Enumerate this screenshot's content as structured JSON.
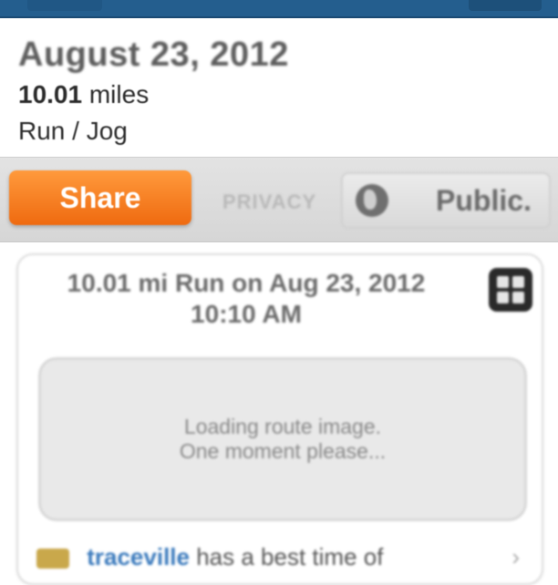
{
  "summary": {
    "date": "August 23, 2012",
    "distance_value": "10.01",
    "distance_unit": "miles",
    "activity_type": "Run / Jog"
  },
  "share_bar": {
    "share_label": "Share",
    "privacy_label": "PRIVACY",
    "privacy_value": "Public."
  },
  "card": {
    "title_line1": "10.01 mi Run on Aug 23, 2012",
    "title_line2": "10:10 AM",
    "loading_line1": "Loading route image.",
    "loading_line2": "One moment please...",
    "friend_username": "traceville",
    "friend_text": "has a best time of",
    "chevron": "›"
  },
  "colors": {
    "header_blue": "#245e8e",
    "share_orange": "#f27a1f",
    "link_blue": "#3c7bbd"
  },
  "icons": [
    "globe-icon",
    "expand-icon",
    "trophy-icon",
    "chevron-right-icon"
  ]
}
